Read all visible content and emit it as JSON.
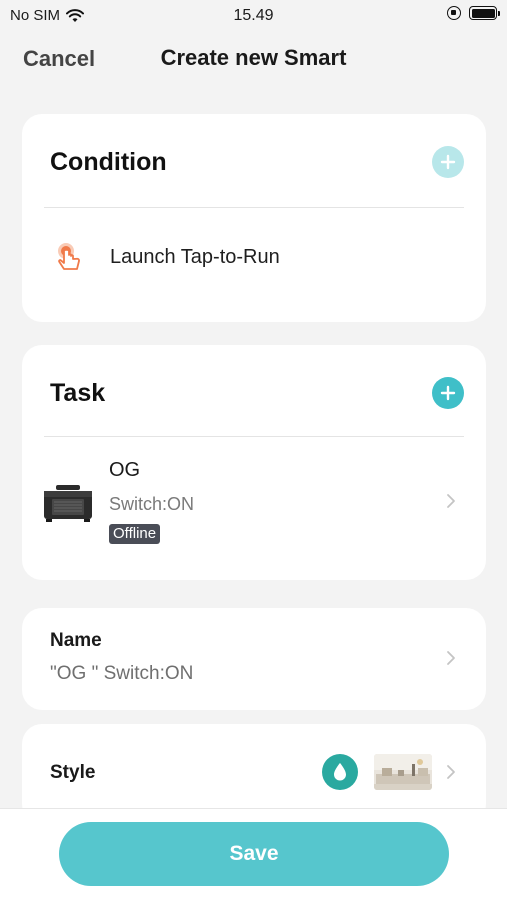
{
  "status_bar": {
    "carrier": "No SIM",
    "time": "15.49"
  },
  "nav": {
    "cancel_label": "Cancel",
    "title": "Create new Smart"
  },
  "condition": {
    "header": "Condition",
    "add_icon": "plus-icon",
    "trigger_icon": "tap-hand-icon",
    "trigger_label": "Launch Tap-to-Run"
  },
  "task": {
    "header": "Task",
    "add_icon": "plus-icon",
    "device": {
      "name": "OG",
      "action": "Switch:ON",
      "status_badge": "Offline"
    }
  },
  "name_section": {
    "label": "Name",
    "value": "\"OG \" Switch:ON"
  },
  "style_section": {
    "label": "Style",
    "color": "#2aa9a0",
    "color_icon": "water-drop-icon"
  },
  "footer": {
    "save_label": "Save",
    "save_color": "#56c6cd"
  },
  "colors": {
    "accent": "#3fbfc8",
    "accent_light": "#b8e7ea",
    "trigger_orange": "#f07a4a",
    "badge_dark": "#4a4d57"
  }
}
